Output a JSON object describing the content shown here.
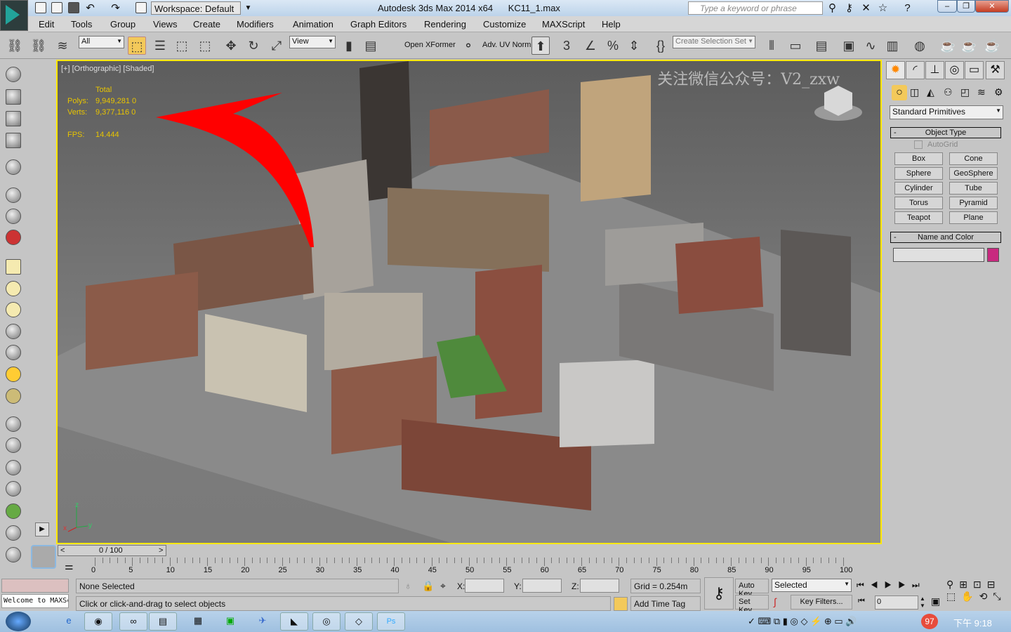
{
  "titlebar": {
    "workspace": "Workspace: Default",
    "app_title": "Autodesk 3ds Max  2014 x64",
    "file": "KC11_1.max",
    "search_placeholder": "Type a keyword or phrase"
  },
  "menu": [
    "Edit",
    "Tools",
    "Group",
    "Views",
    "Create",
    "Modifiers",
    "Animation",
    "Graph Editors",
    "Rendering",
    "Customize",
    "MAXScript",
    "Help"
  ],
  "toolbar": {
    "selection_filter": "All",
    "ref_coord": "View",
    "open_xformer": "Open XFormer",
    "adv_uv": "Adv. UV Norm",
    "snap_3": "3",
    "selection_set_placeholder": "Create Selection Set"
  },
  "viewport": {
    "label": "[+] [Orthographic] [Shaded]",
    "stats_header": "Total",
    "polys_label": "Polys:",
    "polys": "9,949,281  0",
    "verts_label": "Verts:",
    "verts": "9,377,116  0",
    "fps_label": "FPS:",
    "fps": "14.444",
    "watermark": "关注微信公众号：V2_zxw",
    "axes": {
      "x": "x",
      "y": "y",
      "z": "z"
    }
  },
  "command_panel": {
    "category": "Standard Primitives",
    "object_type": "Object Type",
    "autogrid": "AutoGrid",
    "buttons": [
      "Box",
      "Cone",
      "Sphere",
      "GeoSphere",
      "Cylinder",
      "Tube",
      "Torus",
      "Pyramid",
      "Teapot",
      "Plane"
    ],
    "name_and_color": "Name and Color",
    "object_color": "#c8297f",
    "collapse": "-"
  },
  "timeline": {
    "slider": "0 / 100",
    "prev": "<",
    "next": ">",
    "ticks": [
      "0",
      "5",
      "10",
      "15",
      "20",
      "25",
      "30",
      "35",
      "40",
      "45",
      "50",
      "55",
      "60",
      "65",
      "70",
      "75",
      "80",
      "85",
      "90",
      "95",
      "100"
    ]
  },
  "status": {
    "selection": "None Selected",
    "prompt": "Click or click-and-drag to select objects",
    "maxscript": "Welcome to MAXScript",
    "x_label": "X:",
    "y_label": "Y:",
    "z_label": "Z:",
    "grid": "Grid = 0.254m",
    "add_time_tag": "Add Time Tag",
    "auto_key": "Auto Key",
    "set_key": "Set Key",
    "key_mode": "Selected",
    "key_filters": "Key Filters...",
    "frame": "0"
  },
  "taskbar": {
    "notification_count": "97",
    "clock": "下午 9:18"
  },
  "colors": {
    "viewport_border": "#ffe800",
    "stats_text": "#e8c400",
    "arrow": "#ff0000"
  }
}
